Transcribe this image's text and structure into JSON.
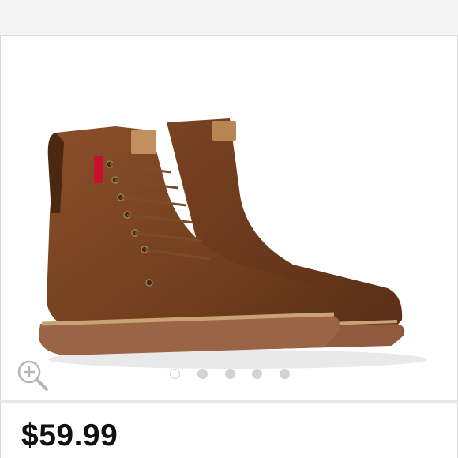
{
  "listing": {
    "price": "$59.99",
    "image_pager": {
      "total": 5,
      "active_index": 0
    }
  },
  "icons": {
    "zoom": "zoom-in-icon"
  },
  "colors": {
    "boot_leather": "#7a4424",
    "sole": "#9b6446",
    "welt": "#c9a276",
    "brand_tag": "#c8102e"
  }
}
